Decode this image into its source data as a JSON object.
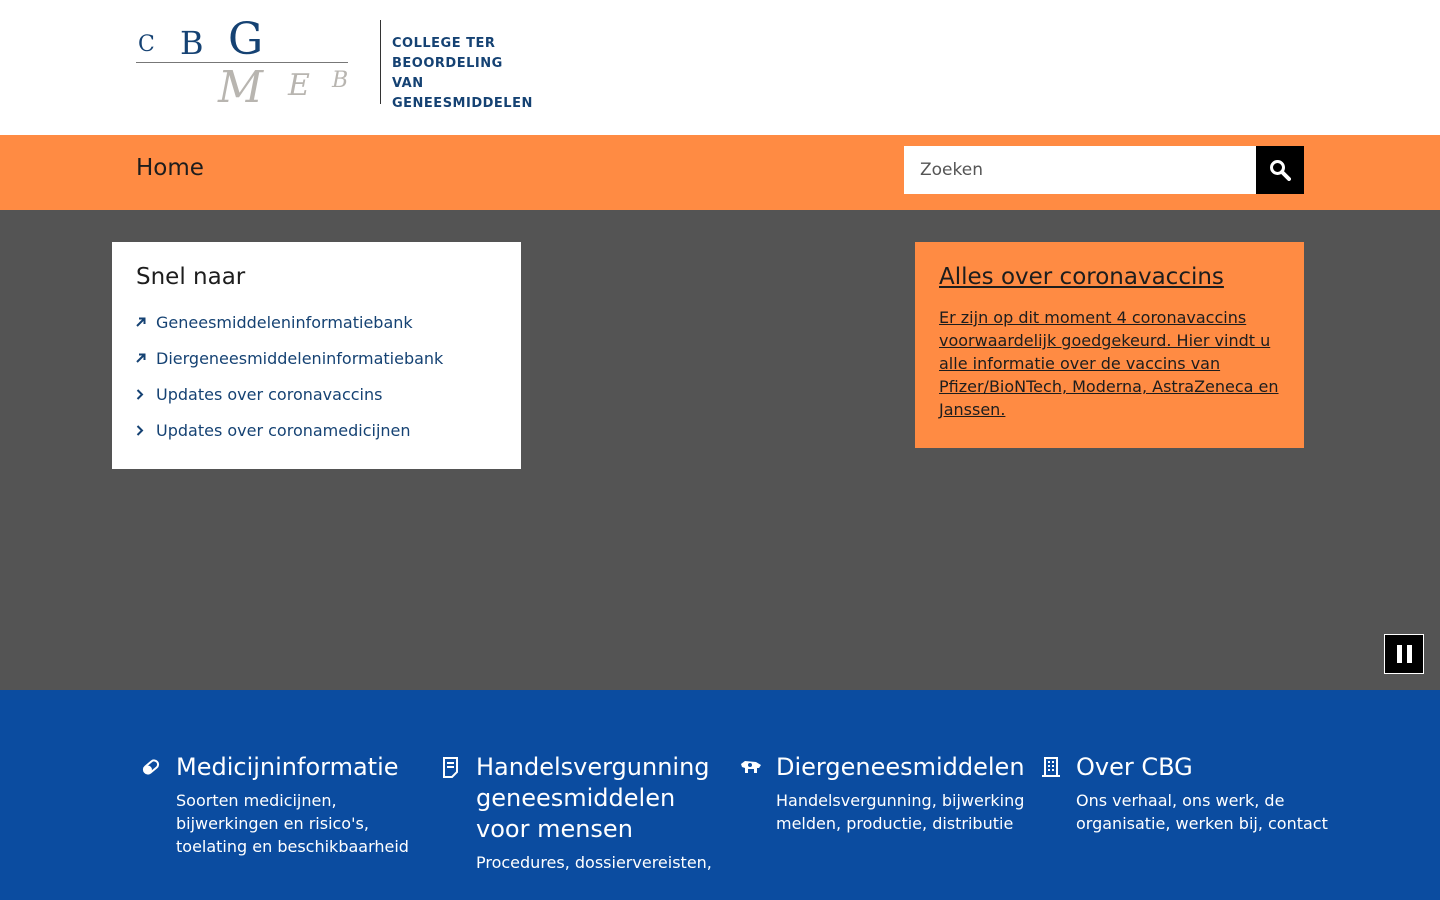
{
  "logo": {
    "letters": {
      "c": "C",
      "b": "B",
      "g": "G",
      "m": "M",
      "e": "E",
      "b2": "B"
    },
    "line1": "COLLEGE TER",
    "line2": "BEOORDELING VAN",
    "line3": "GENEESMIDDELEN"
  },
  "nav": {
    "home": "Home"
  },
  "search": {
    "placeholder": "Zoeken"
  },
  "quick": {
    "title": "Snel naar",
    "items": [
      {
        "label": "Geneesmiddeleninformatiebank",
        "icon": "external-arrow-icon"
      },
      {
        "label": "Diergeneesmiddeleninformatiebank",
        "icon": "external-arrow-icon"
      },
      {
        "label": "Updates over coronavaccins",
        "icon": "chevron-right-icon"
      },
      {
        "label": "Updates over coronamedicijnen",
        "icon": "chevron-right-icon"
      }
    ]
  },
  "promo": {
    "title": "Alles over coronavaccins",
    "text": "Er zijn op dit moment 4 coronavaccins voorwaardelijk goedgekeurd. Hier vindt u alle informatie over de vaccins van Pfizer/BioNTech, Moderna, AstraZeneca en Janssen."
  },
  "tiles": [
    {
      "title": "Medicijninformatie",
      "text": "Soorten medicijnen, bijwerkingen en risico's, toelating en beschikbaarheid",
      "icon": "pill-icon"
    },
    {
      "title": "Handelsvergunning geneesmiddelen voor mensen",
      "text": "Procedures, dossiervereisten,",
      "icon": "document-icon"
    },
    {
      "title": "Diergeneesmiddelen",
      "text": "Handelsvergunning, bijwerking melden, productie, distributie",
      "icon": "animals-icon"
    },
    {
      "title": "Over CBG",
      "text": "Ons verhaal, ons werk, de organisatie, werken bij, contact",
      "icon": "building-icon"
    }
  ],
  "colors": {
    "orange": "#ff8b43",
    "blue": "#0b4ca0",
    "navy": "#154273",
    "hero": "#545454"
  }
}
